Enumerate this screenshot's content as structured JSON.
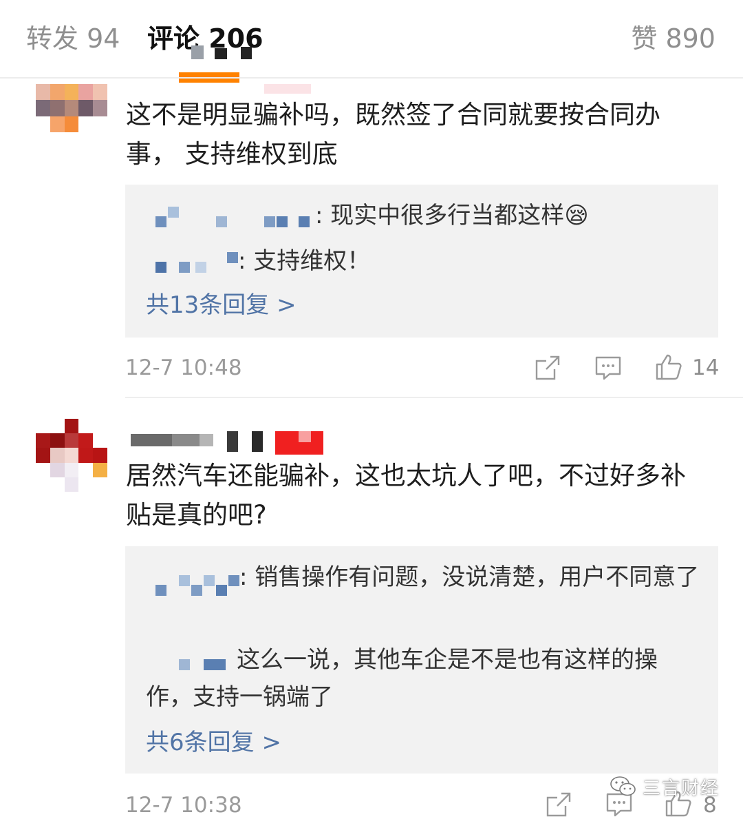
{
  "tabs": {
    "repost_label": "转发 94",
    "comment_label": "评论 206",
    "likes_label": "赞 890",
    "accent_color": "#ff8200"
  },
  "comments": [
    {
      "author": "",
      "text": "这不是明显骗补吗，既然签了合同就要按合同办事， 支持维权到底",
      "replies": [
        {
          "author": "",
          "text": ": 现实中很多行当都这样"
        },
        {
          "author": "",
          "text": ": 支持维权！"
        }
      ],
      "reply_emoji": "😪",
      "more_replies": "共13条回复 >",
      "timestamp": "12-7 10:48",
      "like_count": "14",
      "icons": [
        "share-icon",
        "comment-icon",
        "thumbs-up-icon"
      ]
    },
    {
      "author": "",
      "text": "居然汽车还能骗补，这也太坑人了吧，不过好多补贴是真的吧?",
      "replies": [
        {
          "author": "",
          "text": ": 销售操作有问题，没说清楚，用户不同意了"
        },
        {
          "author": "",
          "text": "这么一说，其他车企是不是也有这样的操作，支持一锅端了"
        }
      ],
      "more_replies": "共6条回复 >",
      "timestamp": "12-7 10:38",
      "like_count": "8",
      "icons": [
        "share-icon",
        "comment-icon",
        "thumbs-up-icon"
      ]
    }
  ],
  "watermark": {
    "text": "三言财经",
    "icon": "wechat-icon"
  },
  "colors": {
    "link": "#5174a6",
    "reply_bg": "#f2f2f2",
    "meta": "#9a9a9a"
  }
}
